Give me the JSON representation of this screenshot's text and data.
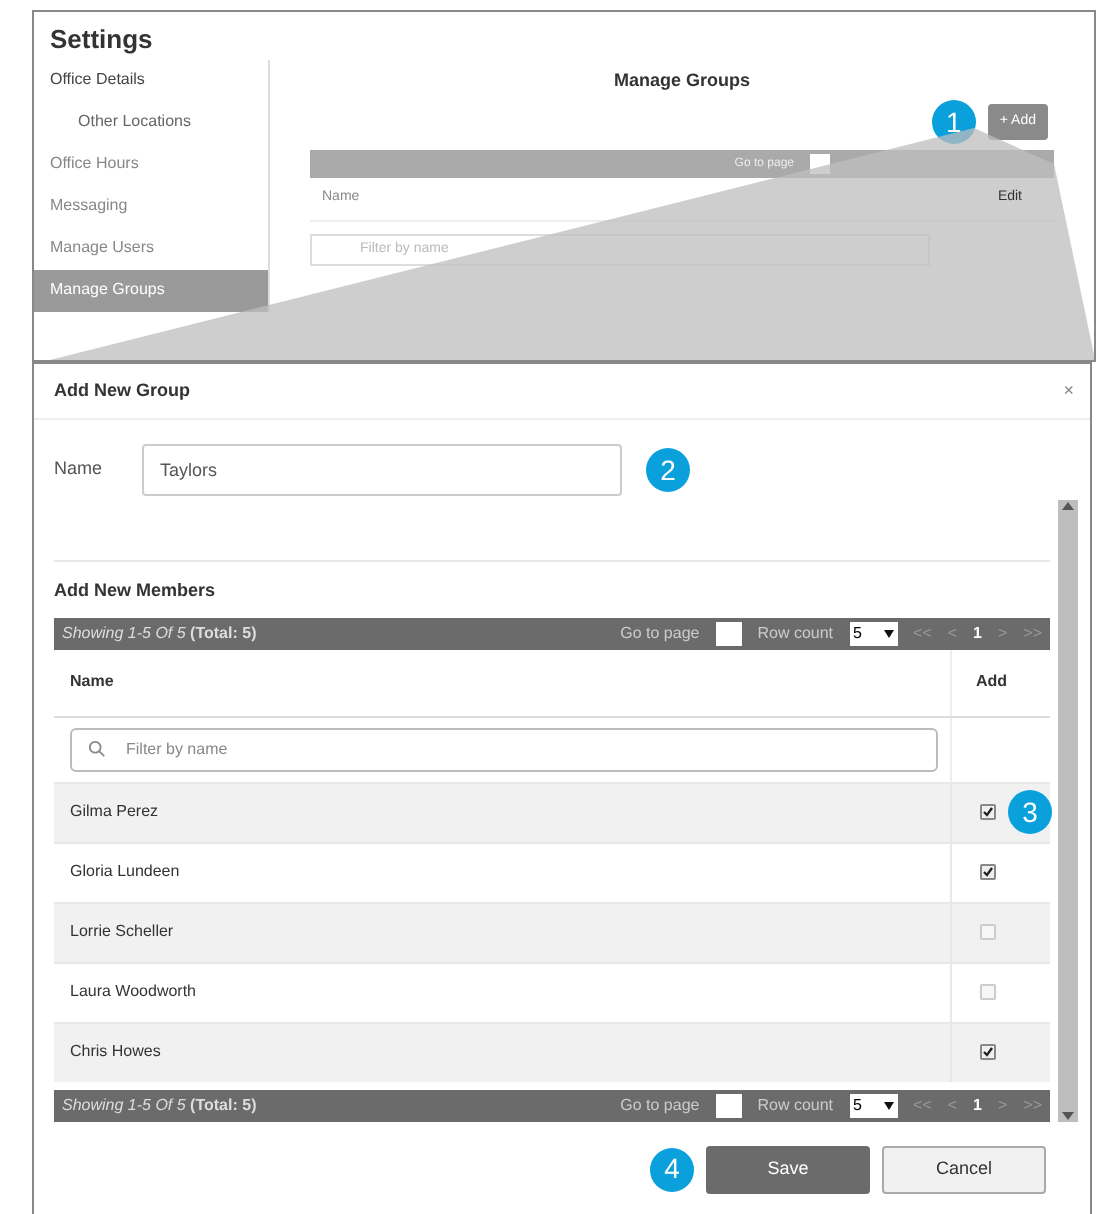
{
  "settings": {
    "title": "Settings",
    "sidebar": [
      {
        "label": "Office Details",
        "selected": false,
        "children": [
          {
            "label": "Other Locations",
            "selected": false
          }
        ]
      },
      {
        "label": "Office Hours",
        "selected": false
      },
      {
        "label": "Messaging",
        "selected": false
      },
      {
        "label": "Manage Users",
        "selected": false
      },
      {
        "label": "Manage Groups",
        "selected": true
      }
    ],
    "heading": "Manage Groups",
    "add_button": "+ Add",
    "pager": {
      "go_to_page": "Go to page"
    },
    "columns": [
      "Name",
      "Edit"
    ],
    "filter": {
      "placeholder": "Filter by name"
    }
  },
  "dialog": {
    "title": "Add New Group",
    "close": "×",
    "name_label": "Name",
    "name_value": "Taylors",
    "members_title": "Add New Members",
    "pagers": [
      {
        "showing": "Showing 1-5 Of 5",
        "total": "(Total: 5)",
        "go_to_page": "Go to page",
        "row_count": "Row count",
        "row_count_value": "5",
        "first": "<<",
        "prev": "<",
        "page": "1",
        "next": ">",
        "last": ">>"
      },
      {
        "showing": "Showing 1-5 Of 5",
        "total": "(Total: 5)",
        "go_to_page": "Go to page",
        "row_count": "Row count",
        "row_count_value": "5",
        "first": "<<",
        "prev": "<",
        "page": "1",
        "next": ">",
        "last": ">>"
      }
    ],
    "columns": [
      "Name",
      "Add"
    ],
    "filter": {
      "placeholder": "Filter by name"
    },
    "members": [
      {
        "name": "Gilma Perez",
        "checked": true
      },
      {
        "name": "Gloria Lundeen",
        "checked": true
      },
      {
        "name": "Lorrie Scheller",
        "checked": false
      },
      {
        "name": "Laura Woodworth",
        "checked": false
      },
      {
        "name": "Chris Howes",
        "checked": true
      }
    ],
    "buttons": {
      "save": "Save",
      "cancel": "Cancel"
    }
  },
  "callouts": [
    "1",
    "2",
    "3",
    "4"
  ]
}
